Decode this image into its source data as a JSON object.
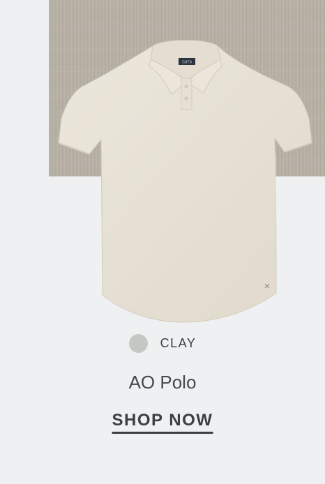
{
  "product": {
    "brand_tag": "CUTS",
    "color": "CLAY",
    "color_hex": "#c4c8c3",
    "shirt_color_hex": "#e7e1d5",
    "fabric_color_hex": "#b9b1a5",
    "name": "AO Polo",
    "cta_label": "SHOP NOW"
  }
}
